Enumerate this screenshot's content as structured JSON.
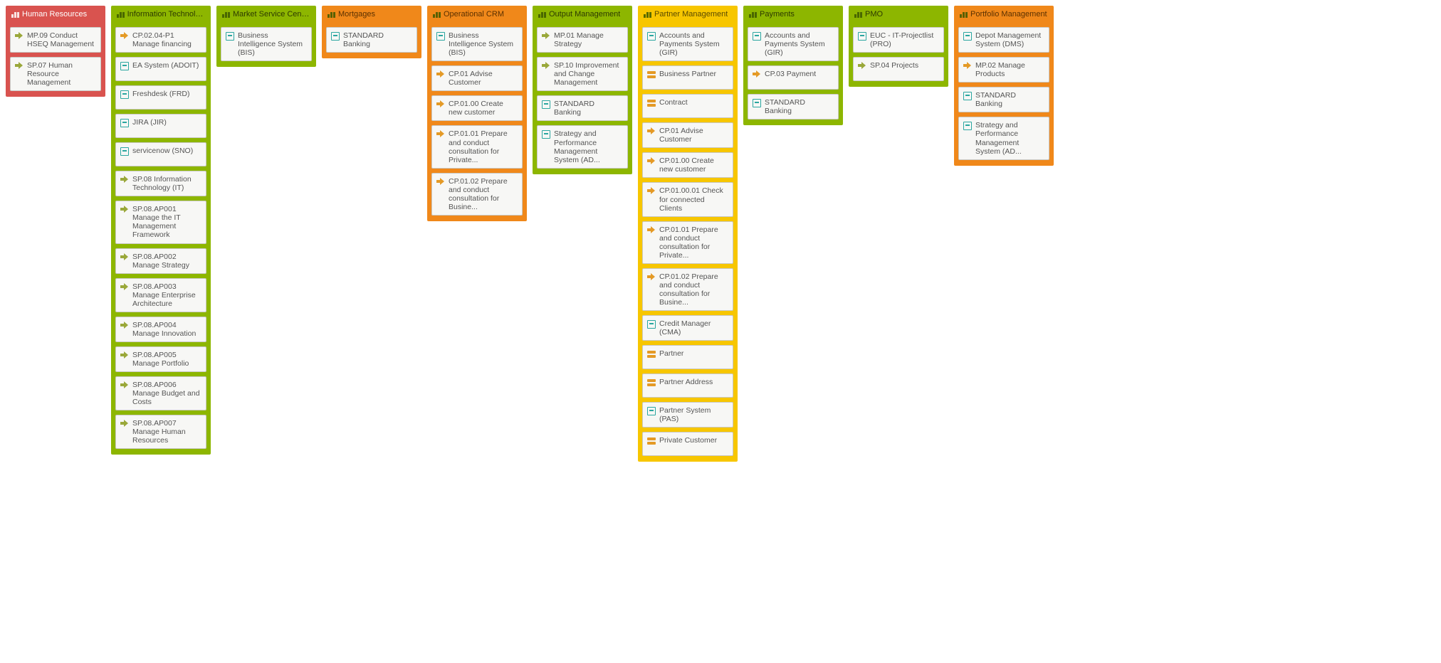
{
  "columns": [
    {
      "id": "human-resources",
      "title": "Human Resources",
      "color": "red",
      "headerIconColor": "white",
      "items": [
        {
          "icon": "arrow",
          "iconColor": "green",
          "label": "MP.09 Conduct HSEQ Management"
        },
        {
          "icon": "arrow",
          "iconColor": "green",
          "label": "SP.07 Human Resource Management"
        }
      ]
    },
    {
      "id": "information-technology",
      "title": "Information Technology",
      "color": "green",
      "headerIconColor": "dkgrn",
      "items": [
        {
          "icon": "arrow",
          "iconColor": "orange",
          "label": "CP.02.04-P1 Manage financing"
        },
        {
          "icon": "app",
          "iconColor": "teal",
          "label": "EA System (ADOIT)"
        },
        {
          "icon": "app",
          "iconColor": "teal",
          "label": "Freshdesk (FRD)"
        },
        {
          "icon": "app",
          "iconColor": "teal",
          "label": "JIRA (JIR)"
        },
        {
          "icon": "app",
          "iconColor": "teal",
          "label": "servicenow (SNO)"
        },
        {
          "icon": "arrow",
          "iconColor": "green",
          "label": "SP.08 Information Technology (IT)"
        },
        {
          "icon": "arrow",
          "iconColor": "green",
          "label": "SP.08.AP001 Manage the IT Management Framework"
        },
        {
          "icon": "arrow",
          "iconColor": "green",
          "label": "SP.08.AP002 Manage Strategy"
        },
        {
          "icon": "arrow",
          "iconColor": "green",
          "label": "SP.08.AP003 Manage Enterprise Architecture"
        },
        {
          "icon": "arrow",
          "iconColor": "green",
          "label": "SP.08.AP004 Manage Innovation"
        },
        {
          "icon": "arrow",
          "iconColor": "green",
          "label": "SP.08.AP005 Manage Portfolio"
        },
        {
          "icon": "arrow",
          "iconColor": "green",
          "label": "SP.08.AP006 Manage Budget and Costs"
        },
        {
          "icon": "arrow",
          "iconColor": "green",
          "label": "SP.08.AP007 Manage Human Resources"
        }
      ]
    },
    {
      "id": "market-service-center",
      "title": "Market Service Center",
      "color": "green",
      "headerIconColor": "dkgrn",
      "items": [
        {
          "icon": "app",
          "iconColor": "teal",
          "label": "Business Intelligence System (BIS)"
        }
      ]
    },
    {
      "id": "mortgages",
      "title": "Mortgages",
      "color": "orange",
      "headerIconColor": "dkgrn",
      "items": [
        {
          "icon": "app",
          "iconColor": "teal",
          "label": "STANDARD Banking"
        }
      ]
    },
    {
      "id": "operational-crm",
      "title": "Operational CRM",
      "color": "orange",
      "headerIconColor": "dkgrn",
      "items": [
        {
          "icon": "app",
          "iconColor": "teal",
          "label": "Business Intelligence System (BIS)"
        },
        {
          "icon": "arrow",
          "iconColor": "orange",
          "label": "CP.01 Advise Customer"
        },
        {
          "icon": "arrow",
          "iconColor": "orange",
          "label": "CP.01.00 Create new customer"
        },
        {
          "icon": "arrow",
          "iconColor": "orange",
          "label": "CP.01.01 Prepare and conduct consultation for Private..."
        },
        {
          "icon": "arrow",
          "iconColor": "orange",
          "label": "CP.01.02 Prepare and conduct consultation for Busine..."
        }
      ]
    },
    {
      "id": "output-management",
      "title": "Output Management",
      "color": "green",
      "headerIconColor": "dkgrn",
      "items": [
        {
          "icon": "arrow",
          "iconColor": "green",
          "label": "MP.01 Manage Strategy"
        },
        {
          "icon": "arrow",
          "iconColor": "green",
          "label": "SP.10 Improvement and Change Management"
        },
        {
          "icon": "app",
          "iconColor": "teal",
          "label": "STANDARD Banking"
        },
        {
          "icon": "app",
          "iconColor": "teal",
          "label": "Strategy and Performance Management System (AD..."
        }
      ]
    },
    {
      "id": "partner-management",
      "title": "Partner Management",
      "color": "yellow",
      "headerIconColor": "dkgrn",
      "items": [
        {
          "icon": "app",
          "iconColor": "teal",
          "label": "Accounts and Payments System (GIR)"
        },
        {
          "icon": "entity",
          "iconColor": "orange",
          "label": "Business Partner"
        },
        {
          "icon": "entity",
          "iconColor": "orange",
          "label": "Contract"
        },
        {
          "icon": "arrow",
          "iconColor": "orange",
          "label": "CP.01 Advise Customer"
        },
        {
          "icon": "arrow",
          "iconColor": "orange",
          "label": "CP.01.00 Create new customer"
        },
        {
          "icon": "arrow",
          "iconColor": "orange",
          "label": "CP.01.00.01 Check for connected Clients"
        },
        {
          "icon": "arrow",
          "iconColor": "orange",
          "label": "CP.01.01 Prepare and conduct consultation for Private..."
        },
        {
          "icon": "arrow",
          "iconColor": "orange",
          "label": "CP.01.02 Prepare and conduct consultation for Busine..."
        },
        {
          "icon": "app",
          "iconColor": "teal",
          "label": "Credit Manager (CMA)"
        },
        {
          "icon": "entity",
          "iconColor": "orange",
          "label": "Partner"
        },
        {
          "icon": "entity",
          "iconColor": "orange",
          "label": "Partner Address"
        },
        {
          "icon": "app",
          "iconColor": "teal",
          "label": "Partner System (PAS)"
        },
        {
          "icon": "entity",
          "iconColor": "orange",
          "label": "Private Customer"
        }
      ]
    },
    {
      "id": "payments",
      "title": "Payments",
      "color": "green",
      "headerIconColor": "dkgrn",
      "items": [
        {
          "icon": "app",
          "iconColor": "teal",
          "label": "Accounts and Payments System (GIR)"
        },
        {
          "icon": "arrow",
          "iconColor": "orange",
          "label": "CP.03 Payment"
        },
        {
          "icon": "app",
          "iconColor": "teal",
          "label": "STANDARD Banking"
        }
      ]
    },
    {
      "id": "pmo",
      "title": "PMO",
      "color": "green",
      "headerIconColor": "dkgrn",
      "items": [
        {
          "icon": "app",
          "iconColor": "teal",
          "label": "EUC - IT-Projectlist (PRO)"
        },
        {
          "icon": "arrow",
          "iconColor": "green",
          "label": "SP.04 Projects"
        }
      ]
    },
    {
      "id": "portfolio-management",
      "title": "Portfolio Management",
      "color": "orange",
      "headerIconColor": "dkgrn",
      "items": [
        {
          "icon": "app",
          "iconColor": "teal",
          "label": "Depot Management System (DMS)"
        },
        {
          "icon": "arrow",
          "iconColor": "orange",
          "label": "MP.02 Manage Products"
        },
        {
          "icon": "app",
          "iconColor": "teal",
          "label": "STANDARD Banking"
        },
        {
          "icon": "app",
          "iconColor": "teal",
          "label": "Strategy and Performance Management System (AD..."
        }
      ]
    }
  ]
}
